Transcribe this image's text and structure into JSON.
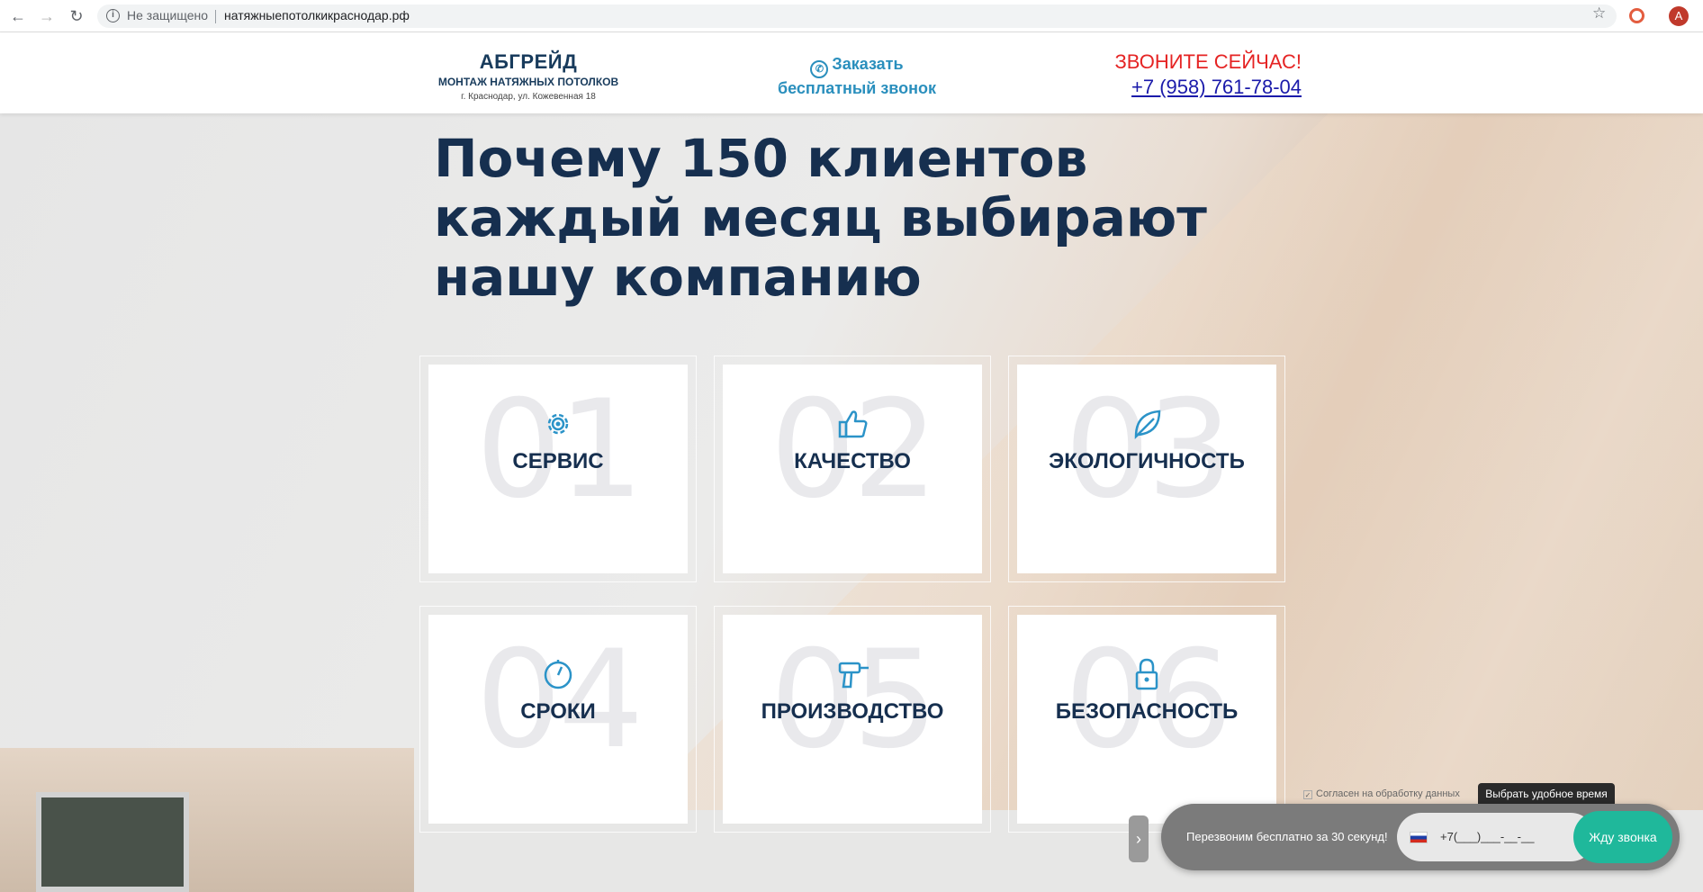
{
  "browser": {
    "security_label": "Не защищено",
    "url": "натяжныепотолкикраснодар.рф",
    "avatar_letter": "A"
  },
  "header": {
    "brand_name": "АБГРЕЙД",
    "brand_subtitle": "МОНТАЖ НАТЯЖНЫХ ПОТОЛКОВ",
    "brand_address": "г. Краснодар, ул. Кожевенная 18",
    "callback_line1": "Заказать",
    "callback_line2": "бесплатный звонок",
    "call_title": "ЗВОНИТЕ СЕЙЧАС!",
    "phone": "+7 (958) 761-78-04"
  },
  "main": {
    "headline": "Почему 150 клиентов каждый месяц выбирают нашу компанию",
    "features": [
      {
        "num": "01",
        "label": "СЕРВИС",
        "icon": "gear-icon"
      },
      {
        "num": "02",
        "label": "КАЧЕСТВО",
        "icon": "thumbs-up-icon"
      },
      {
        "num": "03",
        "label": "ЭКОЛОГИЧНОСТЬ",
        "icon": "leaf-icon"
      },
      {
        "num": "04",
        "label": "СРОКИ",
        "icon": "stopwatch-icon"
      },
      {
        "num": "05",
        "label": "ПРОИЗВОДСТВО",
        "icon": "drill-icon"
      },
      {
        "num": "06",
        "label": "БЕЗОПАСНОСТЬ",
        "icon": "lock-icon"
      }
    ]
  },
  "widget": {
    "consent": "Согласен на обработку данных",
    "pick_time": "Выбрать удобное время",
    "prompt": "Перезвоним бесплатно за 30 секунд!",
    "phone_mask": "+7(___)___-__-__",
    "submit": "Жду звонка"
  },
  "colors": {
    "brand_navy": "#162f4f",
    "accent_blue": "#2b93c8",
    "call_red": "#e52424",
    "submit_green": "#1fb89b"
  }
}
